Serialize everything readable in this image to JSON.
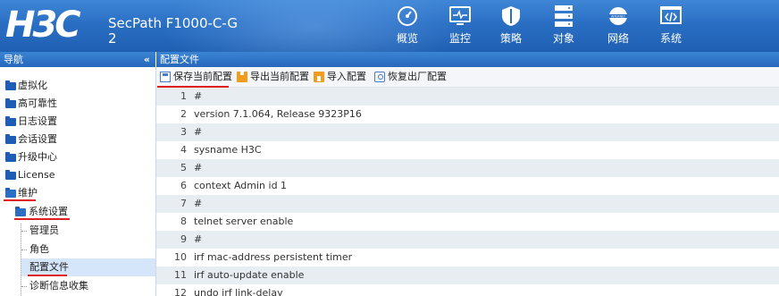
{
  "header": {
    "logo": "H3C",
    "product": "SecPath F1000-C-G2",
    "nav": [
      {
        "label": "概览",
        "icon": "dashboard-icon"
      },
      {
        "label": "监控",
        "icon": "monitor-icon"
      },
      {
        "label": "策略",
        "icon": "shield-icon"
      },
      {
        "label": "对象",
        "icon": "server-stack-icon"
      },
      {
        "label": "网络",
        "icon": "internet-icon"
      },
      {
        "label": "系统",
        "icon": "code-icon"
      }
    ]
  },
  "sidebar": {
    "title": "导航",
    "collapse_glyph": "«",
    "items": [
      {
        "label": "虚拟化"
      },
      {
        "label": "高可靠性"
      },
      {
        "label": "日志设置"
      },
      {
        "label": "会话设置"
      },
      {
        "label": "升级中心"
      },
      {
        "label": "License"
      },
      {
        "label": "维护"
      },
      {
        "label": "系统设置"
      },
      {
        "label": "管理员"
      },
      {
        "label": "角色"
      },
      {
        "label": "配置文件"
      },
      {
        "label": "诊断信息收集"
      }
    ]
  },
  "main": {
    "title": "配置文件",
    "toolbar": {
      "save": "保存当前配置",
      "export": "导出当前配置",
      "import": "导入配置",
      "restore": "恢复出厂配置"
    },
    "lines": [
      {
        "n": "1",
        "text": "#"
      },
      {
        "n": "2",
        "text": "version 7.1.064, Release 9323P16"
      },
      {
        "n": "3",
        "text": "#"
      },
      {
        "n": "4",
        "text": "sysname H3C"
      },
      {
        "n": "5",
        "text": "#"
      },
      {
        "n": "6",
        "text": "context Admin id 1"
      },
      {
        "n": "7",
        "text": "#"
      },
      {
        "n": "8",
        "text": "telnet server enable"
      },
      {
        "n": "9",
        "text": "#"
      },
      {
        "n": "10",
        "text": "irf mac-address persistent timer"
      },
      {
        "n": "11",
        "text": "irf auto-update enable"
      },
      {
        "n": "12",
        "text": "undo irf link-delay"
      }
    ]
  },
  "colors": {
    "header_blue": "#2a6fc4",
    "folder_blue": "#1e5db3",
    "highlight_red": "#e02020",
    "selected_bg": "#d6e6fa"
  }
}
